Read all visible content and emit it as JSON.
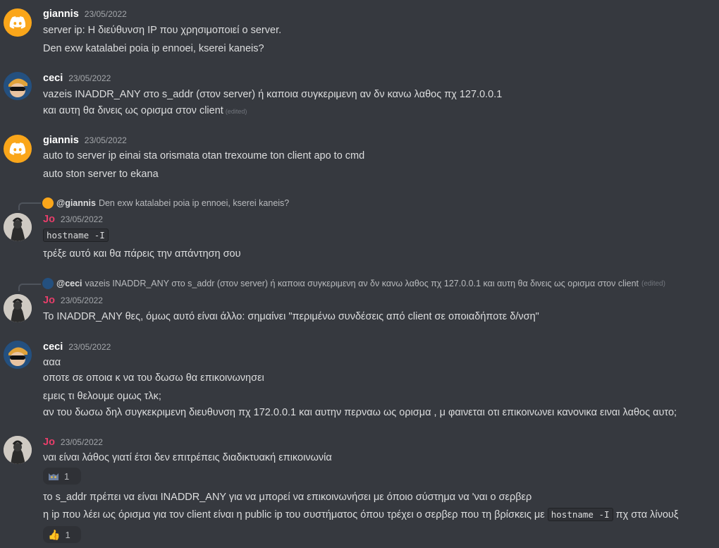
{
  "users": {
    "giannis": "giannis",
    "ceci": "ceci",
    "jo": "Jo"
  },
  "messages": [
    {
      "author": "giannis",
      "timestamp": "23/05/2022",
      "lines": [
        "server ip: Η διεύθυνση IP που χρησιμοποιεί ο server.",
        "Den exw katalabei poia ip ennoei, kserei kaneis?"
      ]
    },
    {
      "author": "ceci",
      "timestamp": "23/05/2022",
      "lines": [
        "vazeis INADDR_ANY στο s_addr (στον server) ή καποια συγκεριμενη αν δν κανω λαθος πχ 127.0.0.1",
        "και αυτη θα δινεις ως ορισμα στον client"
      ],
      "edited": "(edited)"
    },
    {
      "author": "giannis",
      "timestamp": "23/05/2022",
      "lines": [
        "auto to server ip einai sta orismata otan trexoume ton client apo to cmd",
        "auto ston server to ekana"
      ]
    },
    {
      "reply": {
        "name": "@giannis",
        "text": "Den exw katalabei poia ip ennoei, kserei kaneis?"
      },
      "author": "Jo",
      "timestamp": "23/05/2022",
      "code": "hostname -I",
      "lines": [
        "τρέξε αυτό και θα πάρεις την απάντηση σου"
      ]
    },
    {
      "reply": {
        "name": "@ceci",
        "text": "vazeis INADDR_ANY στο s_addr (στον server) ή καποια συγκεριμενη αν δν κανω λαθος πχ 127.0.0.1  και αυτη θα δινεις ως ορισμα στον client",
        "edited": "(edited)"
      },
      "author": "Jo",
      "timestamp": "23/05/2022",
      "lines": [
        "Το INADDR_ANY θες, όμως αυτό είναι άλλο: σημαίνει \"περιμένω συνδέσεις από client σε οποιαδήποτε δ/νση\""
      ]
    },
    {
      "author": "ceci",
      "timestamp": "23/05/2022",
      "lines": [
        "ααα",
        "οποτε σε οποια κ να του δωσω θα επικοινωνησει",
        "εμεις τι θελουμε ομως τλκ;",
        "αν του δωσω δηλ συγκεκριμενη διευθυνση πχ 172.0.0.1 και αυτην περναω ως ορισμα , μ φαινεται οτι επικοινωνει κανονικα ειναι λαθος αυτο;"
      ]
    },
    {
      "author": "Jo",
      "timestamp": "23/05/2022",
      "lines": [
        "ναι είναι λάθος γιατί έτσι δεν επιτρέπεις διαδικτυακή επικοινωνία",
        "το s_addr πρέπει να είναι INADDR_ANY για να μπορεί να επικοινωνήσει με όποιο σύστημα να 'ναι ο σερβερ"
      ],
      "line3_before": "η ip που λέει ως όρισμα για τον client είναι η public ip του συστήματος όπου τρέχει ο σερβερ που τη βρίσκεις με",
      "line3_code": "hostname -I",
      "line3_after": "πχ στα λίνουξ",
      "reactions": [
        {
          "emoji": "cat-emoji",
          "count": "1"
        },
        {
          "emoji": "thumbs-up-emoji",
          "count": "1"
        }
      ]
    }
  ],
  "colors": {
    "background": "#36393f",
    "jo_name": "#e83e6a",
    "discord_avatar": "#faa61a"
  }
}
